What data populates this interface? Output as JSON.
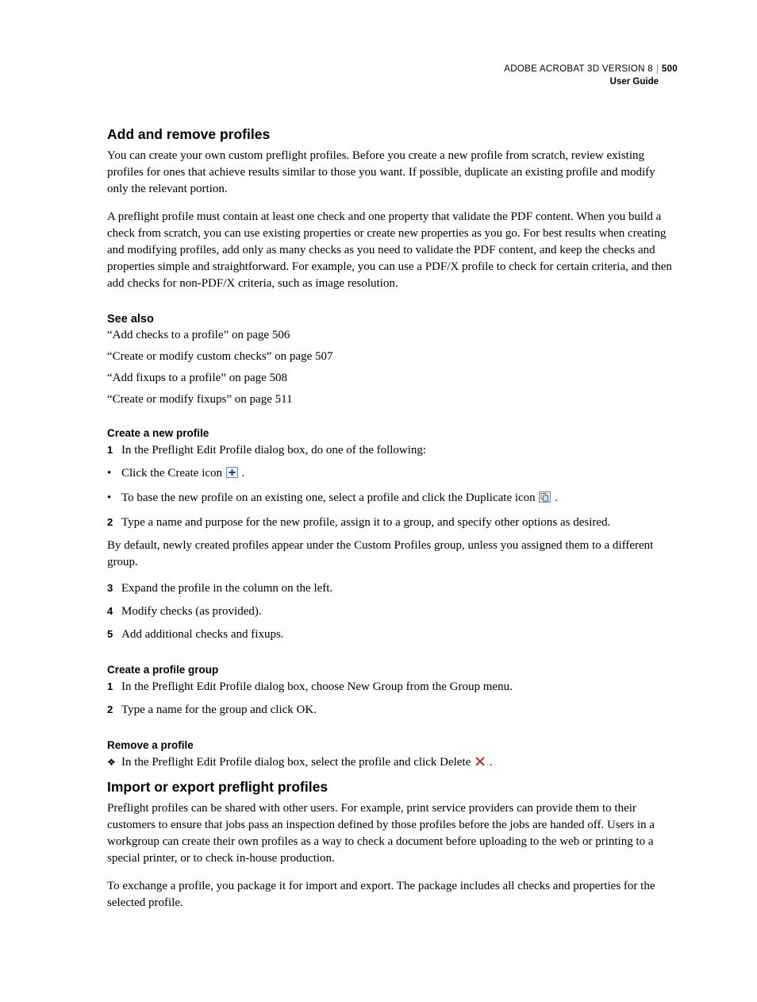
{
  "header": {
    "product": "ADOBE ACROBAT 3D VERSION 8",
    "pagenum": "500",
    "subtitle": "User Guide"
  },
  "s1": {
    "title": "Add and remove profiles",
    "p1": "You can create your own custom preflight profiles. Before you create a new profile from scratch, review existing profiles for ones that achieve results similar to those you want. If possible, duplicate an existing profile and modify only the relevant portion.",
    "p2": "A preflight profile must contain at least one check and one property that validate the PDF content. When you build a check from scratch, you can use existing properties or create new properties as you go. For best results when creating and modifying profiles, add only as many checks as you need to validate the PDF content, and keep the checks and properties simple and straightforward. For example, you can use a PDF/X profile to check for certain criteria, and then add checks for non-PDF/X criteria, such as image resolution."
  },
  "seealso": {
    "title": "See also",
    "items": [
      "“Add checks to a profile” on page 506",
      "“Create or modify custom checks” on page 507",
      "“Add fixups to a profile” on page 508",
      "“Create or modify fixups” on page 511"
    ]
  },
  "create": {
    "title": "Create a new profile",
    "step1": "In the Preflight Edit Profile dialog box, do one of the following:",
    "b1a": "Click the Create icon ",
    "b1b": ".",
    "b2a": "To base the new profile on an existing one, select a profile and click the Duplicate icon ",
    "b2b": ".",
    "step2": "Type a name and purpose for the new profile, assign it to a group, and specify other options as desired.",
    "note": "By default, newly created profiles appear under the Custom Profiles group, unless you assigned them to a different group.",
    "step3": "Expand the profile in the column on the left.",
    "step4": "Modify checks (as provided).",
    "step5": "Add additional checks and fixups."
  },
  "group": {
    "title": "Create a profile group",
    "step1": "In the Preflight Edit Profile dialog box, choose New Group from the Group menu.",
    "step2": "Type a name for the group and click OK."
  },
  "remove": {
    "title": "Remove a profile",
    "t1a": "In the Preflight Edit Profile dialog box, select the profile and click Delete ",
    "t1b": "."
  },
  "s2": {
    "title": "Import or export preflight profiles",
    "p1": "Preflight profiles can be shared with other users. For example, print service providers can provide them to their customers to ensure that jobs pass an inspection defined by those profiles before the jobs are handed off. Users in a workgroup can create their own profiles as a way to check a document before uploading to the web or printing to a special printer, or to check in-house production.",
    "p2": "To exchange a profile, you package it for import and export. The package includes all checks and properties for the selected profile."
  },
  "markers": {
    "n1": "1",
    "n2": "2",
    "n3": "3",
    "n4": "4",
    "n5": "5"
  }
}
